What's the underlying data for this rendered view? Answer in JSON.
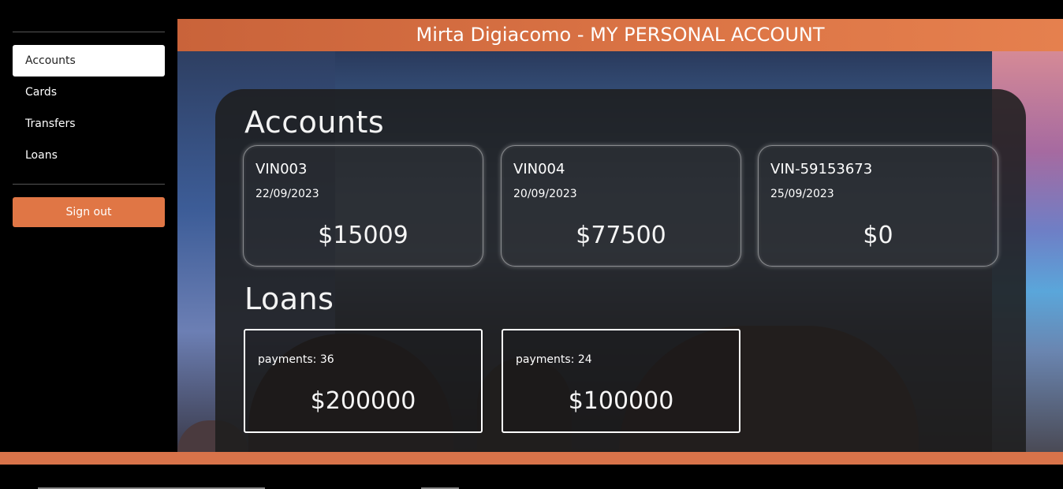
{
  "header": {
    "title": "Mirta Digiacomo - MY PERSONAL ACCOUNT"
  },
  "sidebar": {
    "items": [
      {
        "label": "Accounts",
        "active": true
      },
      {
        "label": "Cards",
        "active": false
      },
      {
        "label": "Transfers",
        "active": false
      },
      {
        "label": "Loans",
        "active": false
      }
    ],
    "signout_label": "Sign out"
  },
  "accounts": {
    "title": "Accounts",
    "items": [
      {
        "number": "VIN003",
        "date": "22/09/2023",
        "balance": "$15009"
      },
      {
        "number": "VIN004",
        "date": "20/09/2023",
        "balance": "$77500"
      },
      {
        "number": "VIN-59153673",
        "date": "25/09/2023",
        "balance": "$0"
      }
    ]
  },
  "loans": {
    "title": "Loans",
    "items": [
      {
        "payments": "payments: 36",
        "amount": "$200000"
      },
      {
        "payments": "payments: 24",
        "amount": "$100000"
      }
    ]
  },
  "colors": {
    "accent": "#e07645",
    "panel": "#1e1e1e"
  }
}
